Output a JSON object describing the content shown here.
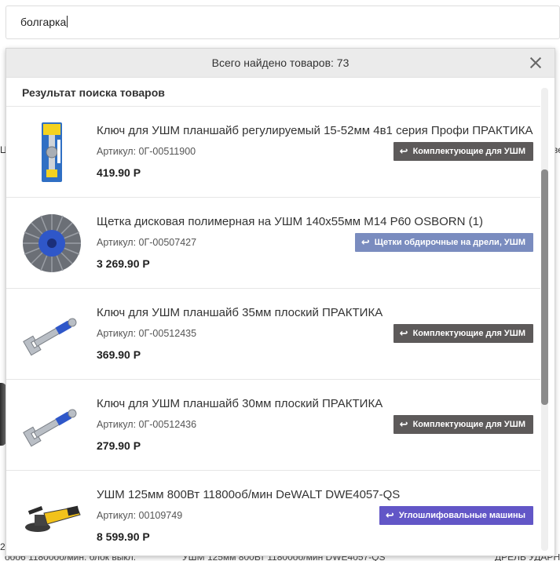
{
  "search": {
    "value": "болгарка"
  },
  "dropdown": {
    "total_text": "Всего найдено товаров: 73",
    "results_title": "Результат поиска товаров"
  },
  "background": {
    "left_fragment": "Це",
    "right_fragment": "ве",
    "bottom_left_fragment": "2",
    "bottom_text_1": "ооо6 11800об/мин. блок выкл.",
    "bottom_text_2": "УШМ 125мм 800Вт 11800об/мин DWE4057-QS",
    "bottom_text_3": "ДРЕЛЬ УДАРН.S"
  },
  "items": [
    {
      "name": "Ключ для УШМ планшайб регулируемый 15-52мм 4в1 серия Профи ПРАКТИКА",
      "sku": "Артикул: 0Г-00511900",
      "price": "419.90 Р",
      "category": "Комплектующие для УШМ",
      "image": "adjustable-wrench-package",
      "category_color": "#5d5a5a"
    },
    {
      "name": "Щетка дисковая полимерная на УШМ 140х55мм М14 Р60 OSBORN (1)",
      "sku": "Артикул: 0Г-00507427",
      "price": "3 269.90 Р",
      "category": "Щетки обдирочные на дрели, УШМ",
      "image": "disc-brush",
      "category_color": "#7a8cbf"
    },
    {
      "name": "Ключ для УШМ планшайб 35мм плоский ПРАКТИКА",
      "sku": "Артикул: 0Г-00512435",
      "price": "369.90 Р",
      "category": "Комплектующие для УШМ",
      "image": "flat-pin-wrench",
      "category_color": "#5d5a5a"
    },
    {
      "name": "Ключ для УШМ планшайб 30мм плоский ПРАКТИКА",
      "sku": "Артикул: 0Г-00512436",
      "price": "279.90 Р",
      "category": "Комплектующие для УШМ",
      "image": "flat-pin-wrench",
      "category_color": "#5d5a5a"
    },
    {
      "name": "УШМ 125мм 800Вт 11800об/мин DeWALT DWE4057-QS",
      "sku": "Артикул: 00109749",
      "price": "8 599.90 Р",
      "category": "Углошлифовальные машины",
      "image": "angle-grinder",
      "category_color": "#6256c7"
    }
  ]
}
